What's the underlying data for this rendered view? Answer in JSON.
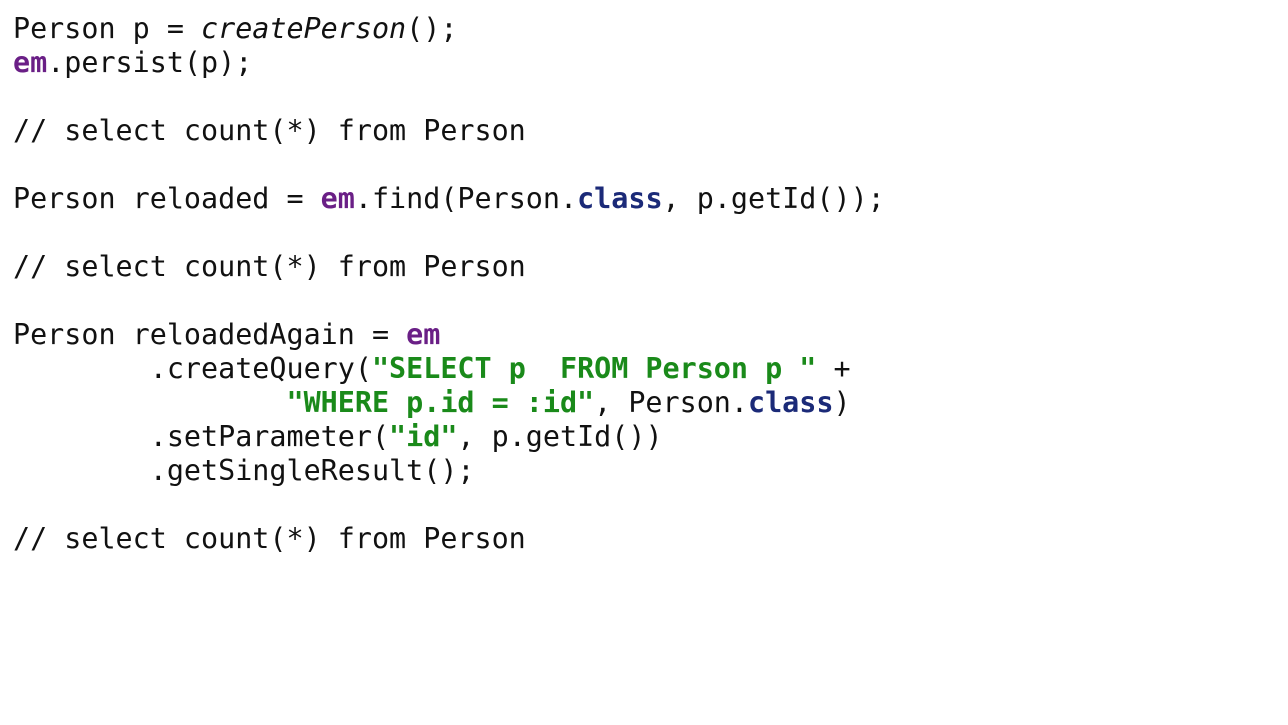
{
  "slide": {
    "lines": [
      {
        "tokens": [
          {
            "t": "Person p = ",
            "k": "plain"
          },
          {
            "t": "createPerson",
            "k": "italic"
          },
          {
            "t": "();",
            "k": "plain"
          }
        ]
      },
      {
        "tokens": [
          {
            "t": "em",
            "k": "em"
          },
          {
            "t": ".persist(p);",
            "k": "plain"
          }
        ]
      },
      {
        "tokens": []
      },
      {
        "tokens": [
          {
            "t": "// select count(*) from Person",
            "k": "comment"
          }
        ]
      },
      {
        "tokens": []
      },
      {
        "tokens": [
          {
            "t": "Person reloaded = ",
            "k": "plain"
          },
          {
            "t": "em",
            "k": "em"
          },
          {
            "t": ".find(Person.",
            "k": "plain"
          },
          {
            "t": "class",
            "k": "class"
          },
          {
            "t": ", p.getId());",
            "k": "plain"
          }
        ]
      },
      {
        "tokens": []
      },
      {
        "tokens": [
          {
            "t": "// select count(*) from Person",
            "k": "comment"
          }
        ]
      },
      {
        "tokens": []
      },
      {
        "tokens": [
          {
            "t": "Person reloadedAgain = ",
            "k": "plain"
          },
          {
            "t": "em",
            "k": "em"
          }
        ]
      },
      {
        "tokens": [
          {
            "t": "        .createQuery(",
            "k": "plain"
          },
          {
            "t": "\"SELECT p  FROM Person p \"",
            "k": "string"
          },
          {
            "t": " +",
            "k": "plain"
          }
        ]
      },
      {
        "tokens": [
          {
            "t": "                ",
            "k": "plain"
          },
          {
            "t": "\"WHERE p.id = :id\"",
            "k": "string"
          },
          {
            "t": ", Person.",
            "k": "plain"
          },
          {
            "t": "class",
            "k": "class"
          },
          {
            "t": ")",
            "k": "plain"
          }
        ]
      },
      {
        "tokens": [
          {
            "t": "        .setParameter(",
            "k": "plain"
          },
          {
            "t": "\"id\"",
            "k": "string"
          },
          {
            "t": ", p.getId())",
            "k": "plain"
          }
        ]
      },
      {
        "tokens": [
          {
            "t": "        .getSingleResult();",
            "k": "plain"
          }
        ]
      },
      {
        "tokens": []
      },
      {
        "tokens": [
          {
            "t": "// select count(*) from Person",
            "k": "comment"
          }
        ]
      }
    ]
  },
  "colors": {
    "background": "#ffffff",
    "text": "#111111",
    "em_keyword": "#6a1f86",
    "class_keyword": "#1b2a78",
    "string_literal": "#1a8a1a"
  }
}
